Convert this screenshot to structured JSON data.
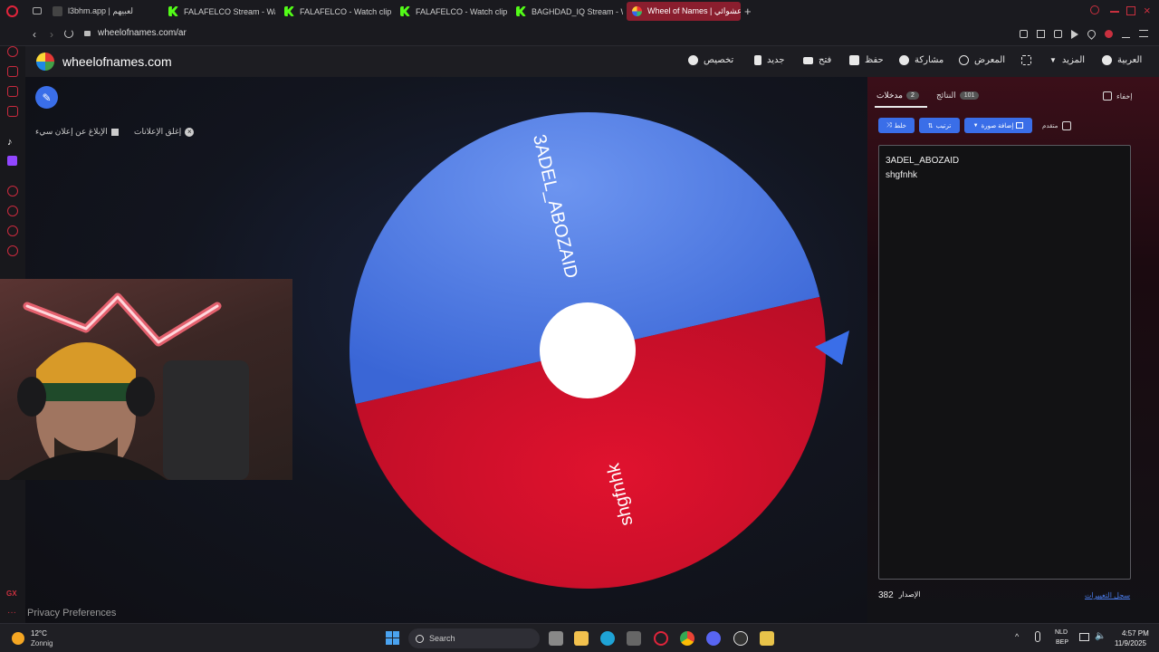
{
  "browser": {
    "tabs": [
      {
        "title": "l3bhm.app | لعبيهم",
        "active": false
      },
      {
        "title": "FALAFELCO Stream - Wat",
        "active": false
      },
      {
        "title": "FALAFELCO - Watch clips",
        "active": false
      },
      {
        "title": "FALAFELCO - Watch clips",
        "active": false
      },
      {
        "title": "BAGHDAD_IQ Stream - W",
        "active": false
      },
      {
        "title": "Wheel of Names | عشوائي",
        "active": true
      }
    ],
    "url": "wheelofnames.com/ar"
  },
  "site": {
    "logo_text": "wheelofnames.com",
    "nav": {
      "customize": "تخصيص",
      "new": "جديد",
      "open": "فتح",
      "save": "حفظ",
      "share": "مشاركة",
      "gallery": "المعرض",
      "more": "المزيد",
      "language": "العربية"
    },
    "close_ads": "إغلق الإعلانات",
    "report_ad": "الإبلاغ عن إعلان سيء",
    "privacy": "Privacy Preferences"
  },
  "wheel": {
    "segments": [
      {
        "label": "3ADEL_ABOZAID",
        "color": "#4a7be8"
      },
      {
        "label": "shgfnhk",
        "color": "#d0112b"
      }
    ],
    "pointer_color": "#3a6ee8"
  },
  "panel": {
    "hide_label": "إخفاء",
    "tabs": {
      "entries_label": "مدخلات",
      "entries_count": "2",
      "results_label": "النتائج",
      "results_count": "101"
    },
    "toolbar": {
      "shuffle": "خلط",
      "sort": "ترتيب",
      "add_image": "إضافة صورة",
      "advanced": "متقدم"
    },
    "entries": [
      "3ADEL_ABOZAID",
      "shgfnhk"
    ],
    "version_label": "الإصدار",
    "version_number": "382",
    "changelog": "سجل التغييرات"
  },
  "taskbar": {
    "weather_temp": "12°C",
    "weather_desc": "Zonnig",
    "search_placeholder": "Search",
    "lang_top": "NLD",
    "lang_bottom": "BEP",
    "time": "4:57 PM",
    "date": "11/9/2025"
  },
  "webcam": {
    "description": "Streamer webcam overlay"
  }
}
